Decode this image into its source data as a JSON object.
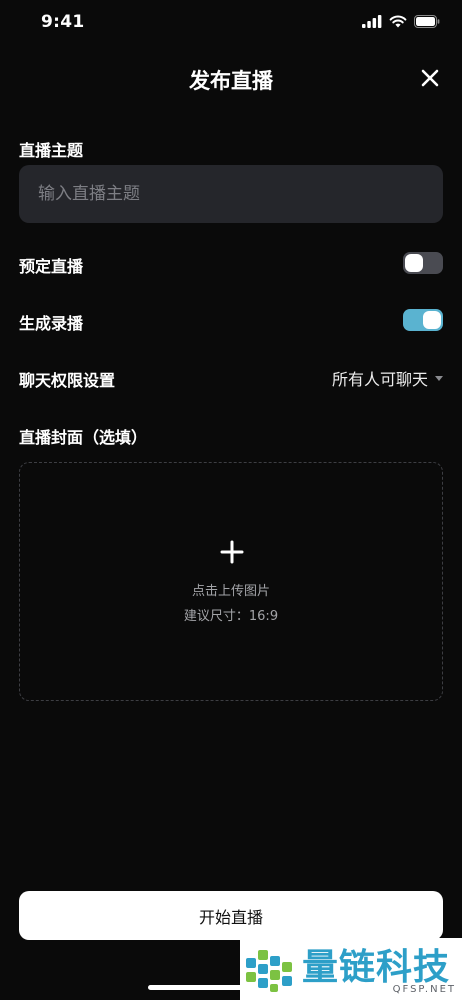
{
  "status_bar": {
    "time": "9:41",
    "icons": [
      "cellular-signal-icon",
      "wifi-icon",
      "battery-icon"
    ]
  },
  "header": {
    "title": "发布直播",
    "close_icon": "close-icon"
  },
  "topic": {
    "label": "直播主题",
    "placeholder": "输入直播主题",
    "value": ""
  },
  "scheduled_live": {
    "label": "预定直播",
    "enabled": false
  },
  "generate_replay": {
    "label": "生成录播",
    "enabled": true
  },
  "chat_permission": {
    "label": "聊天权限设置",
    "selected": "所有人可聊天"
  },
  "cover": {
    "label": "直播封面（选填）",
    "upload_hint": "点击上传图片",
    "size_hint": "建议尺寸：16:9"
  },
  "start_button": {
    "label": "开始直播"
  },
  "watermark": {
    "name": "量链科技",
    "domain": "QFSP.NET"
  },
  "colors": {
    "background": "#0a0a0a",
    "input_background": "#25262b",
    "toggle_on": "#5ab3d0",
    "toggle_off": "#4a4b52",
    "button_background": "#ffffff",
    "watermark_accent": "#2d9fc8"
  }
}
